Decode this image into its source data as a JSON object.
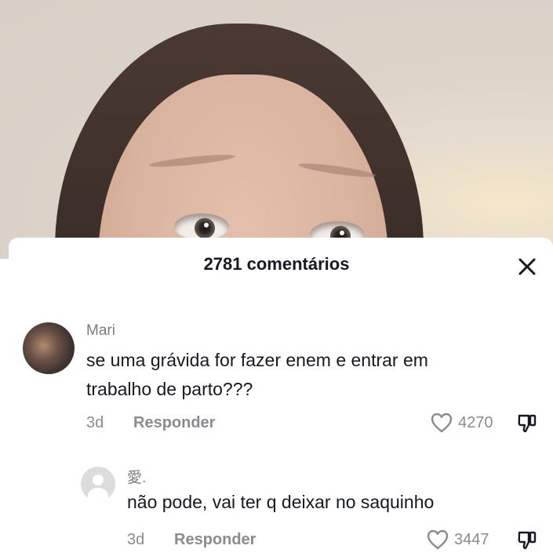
{
  "video": {
    "alt": "video frame of a person"
  },
  "panel": {
    "title": "2781 comentários",
    "close_icon": "close-icon"
  },
  "comments": [
    {
      "username": "Mari",
      "text_lines": [
        "se uma grávida for fazer enem e entrar em",
        "trabalho de parto???"
      ],
      "age": "3d",
      "reply_label": "Responder",
      "likes": "4270",
      "avatar": "user-photo"
    }
  ],
  "replies": [
    {
      "username": "愛.",
      "text": "não pode, vai ter q deixar no saquinho",
      "age": "3d",
      "reply_label": "Responder",
      "likes": "3447",
      "avatar": "default-avatar-icon"
    }
  ],
  "colors": {
    "text": "#161823",
    "muted": "#8a8b91",
    "panel": "#ffffff"
  },
  "icons": [
    "close-icon",
    "heart-icon",
    "thumbs-down-icon",
    "default-avatar-icon"
  ]
}
